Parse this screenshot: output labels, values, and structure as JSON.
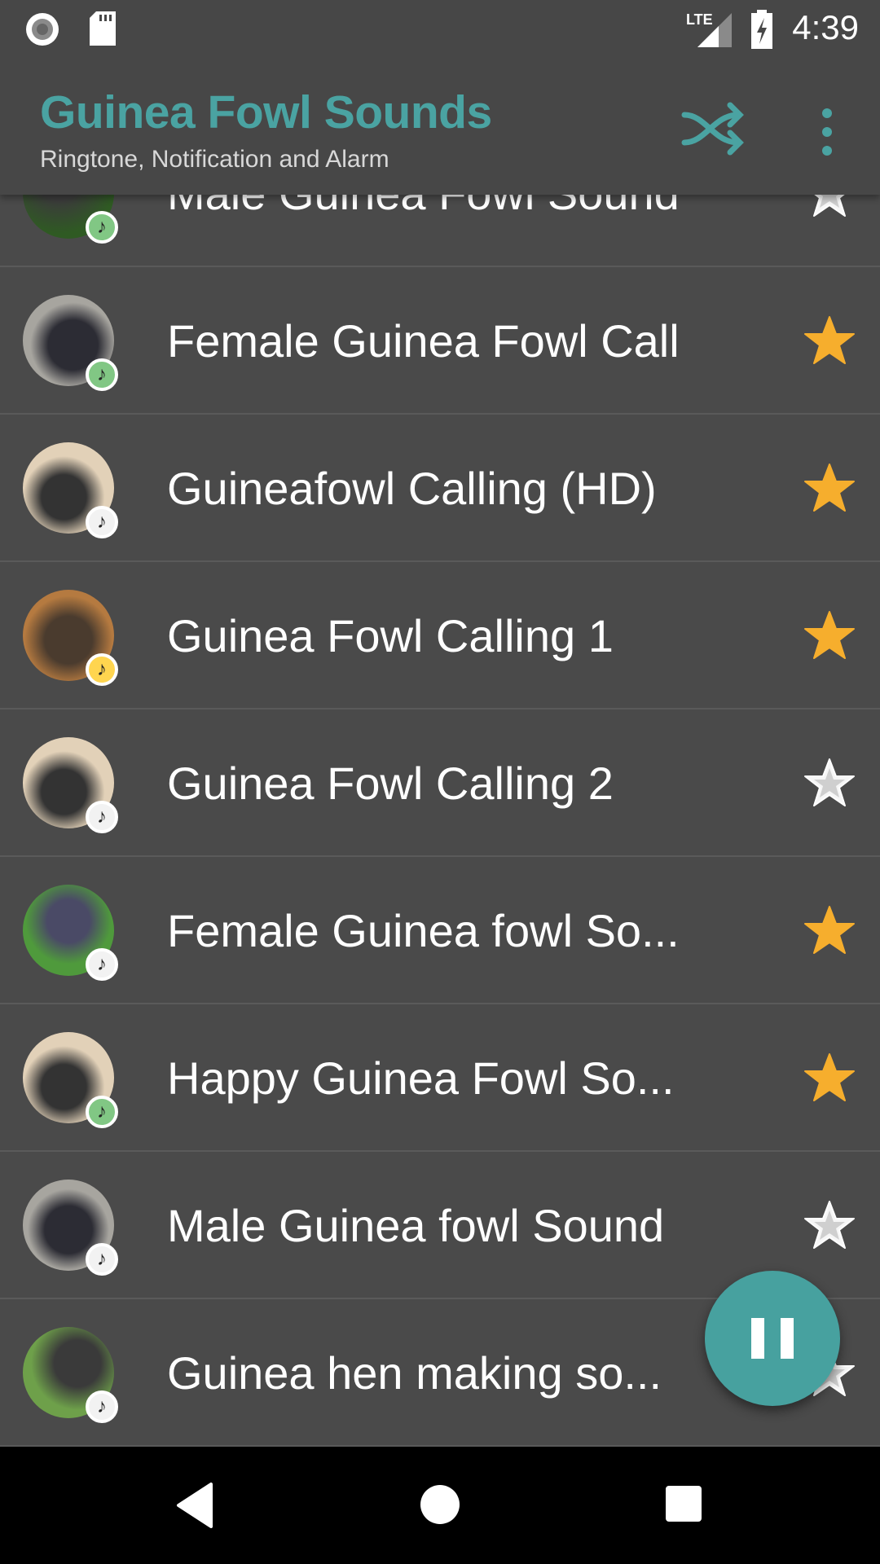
{
  "status_bar": {
    "time": "4:39",
    "network": "LTE"
  },
  "app_bar": {
    "title": "Guinea Fowl Sounds",
    "subtitle": "Ringtone, Notification and Alarm",
    "accent": "#4aa3a2"
  },
  "sounds": [
    {
      "title": "Male Guinea Fowl Sound",
      "badge": "green",
      "favorite": false
    },
    {
      "title": "Female Guinea Fowl Call",
      "badge": "green",
      "favorite": true
    },
    {
      "title": "Guineafowl Calling (HD)",
      "badge": "white",
      "favorite": true
    },
    {
      "title": "Guinea Fowl Calling 1",
      "badge": "yellow",
      "favorite": true
    },
    {
      "title": "Guinea Fowl Calling 2",
      "badge": "white",
      "favorite": false
    },
    {
      "title": "Female Guinea fowl So...",
      "badge": "white",
      "favorite": true
    },
    {
      "title": "Happy Guinea Fowl So...",
      "badge": "green",
      "favorite": true
    },
    {
      "title": "Male Guinea fowl Sound",
      "badge": "white",
      "favorite": false
    },
    {
      "title": "Guinea hen making so...",
      "badge": "white",
      "favorite": false
    }
  ],
  "colors": {
    "green": "#81c784",
    "white": "#f2f2f2",
    "yellow": "#ffd54f",
    "star_on": "#f6ae2d",
    "star_off": "#ffffff"
  },
  "fab": {
    "icon": "pause-icon"
  }
}
